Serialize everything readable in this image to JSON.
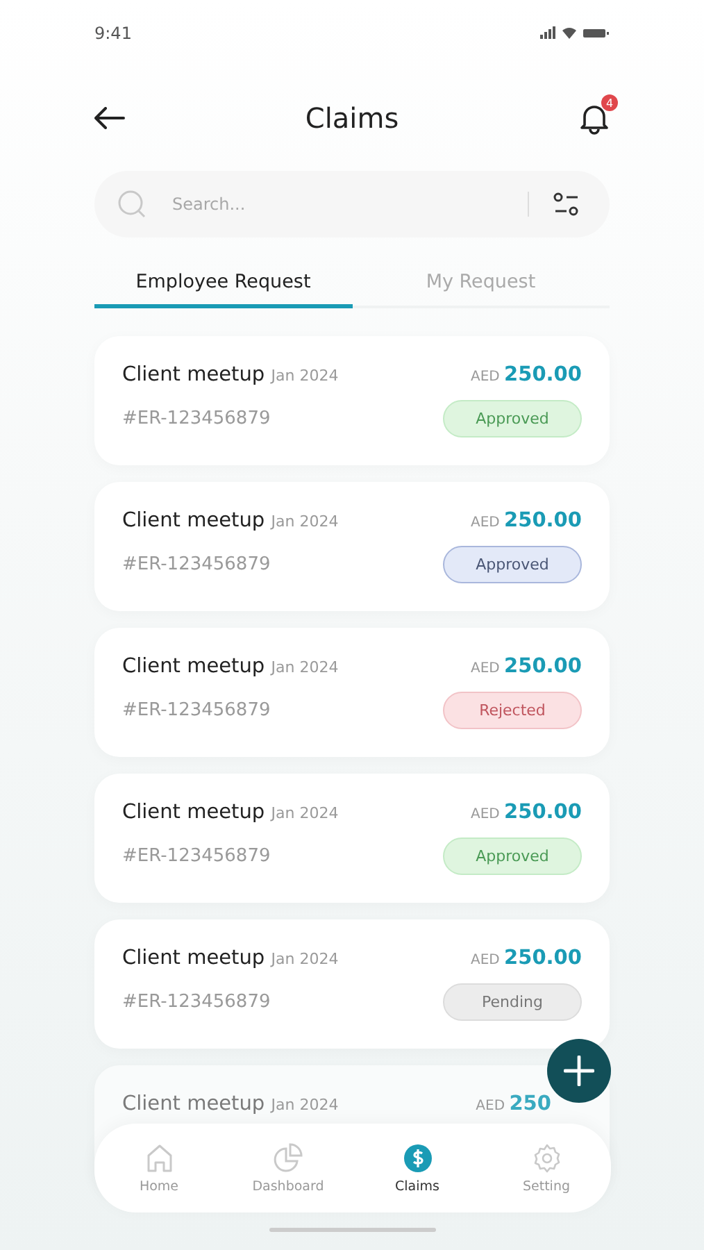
{
  "status_bar": {
    "time": "9:41"
  },
  "header": {
    "title": "Claims",
    "notification_count": "4"
  },
  "search": {
    "placeholder": "Search..."
  },
  "tabs": [
    {
      "label": "Employee Request",
      "selected": true
    },
    {
      "label": "My Request",
      "selected": false
    }
  ],
  "claims": [
    {
      "title": "Client meetup",
      "date": "Jan 2024",
      "currency": "AED",
      "amount": "250.00",
      "id": "#ER-123456879",
      "status": "Approved",
      "color": "#dff5df",
      "faded": false
    },
    {
      "title": "Client meetup",
      "date": "Jan 2024",
      "currency": "AED",
      "amount": "250.00",
      "id": "#ER-123456879",
      "status": "Approved",
      "color": "#e3e9f8",
      "faded": false
    },
    {
      "title": "Client meetup",
      "date": "Jan 2024",
      "currency": "AED",
      "amount": "250.00",
      "id": "#ER-123456879",
      "status": "Rejected",
      "color": "#fbe1e3",
      "faded": false
    },
    {
      "title": "Client meetup",
      "date": "Jan 2024",
      "currency": "AED",
      "amount": "250.00",
      "id": "#ER-123456879",
      "status": "Approved",
      "color": "#dff5df",
      "faded": false
    },
    {
      "title": "Client meetup",
      "date": "Jan 2024",
      "currency": "AED",
      "amount": "250.00",
      "id": "#ER-123456879",
      "status": "Pending",
      "color": "#ececec",
      "faded": false
    },
    {
      "title": "Client meetup",
      "date": "Jan 2024",
      "currency": "AED",
      "amount": "250",
      "faded": true
    }
  ],
  "nav": [
    {
      "label": "Home",
      "selected": false
    },
    {
      "label": "Dashboard",
      "selected": false
    },
    {
      "label": "Claims",
      "selected": true
    },
    {
      "label": "Setting",
      "selected": false
    }
  ]
}
